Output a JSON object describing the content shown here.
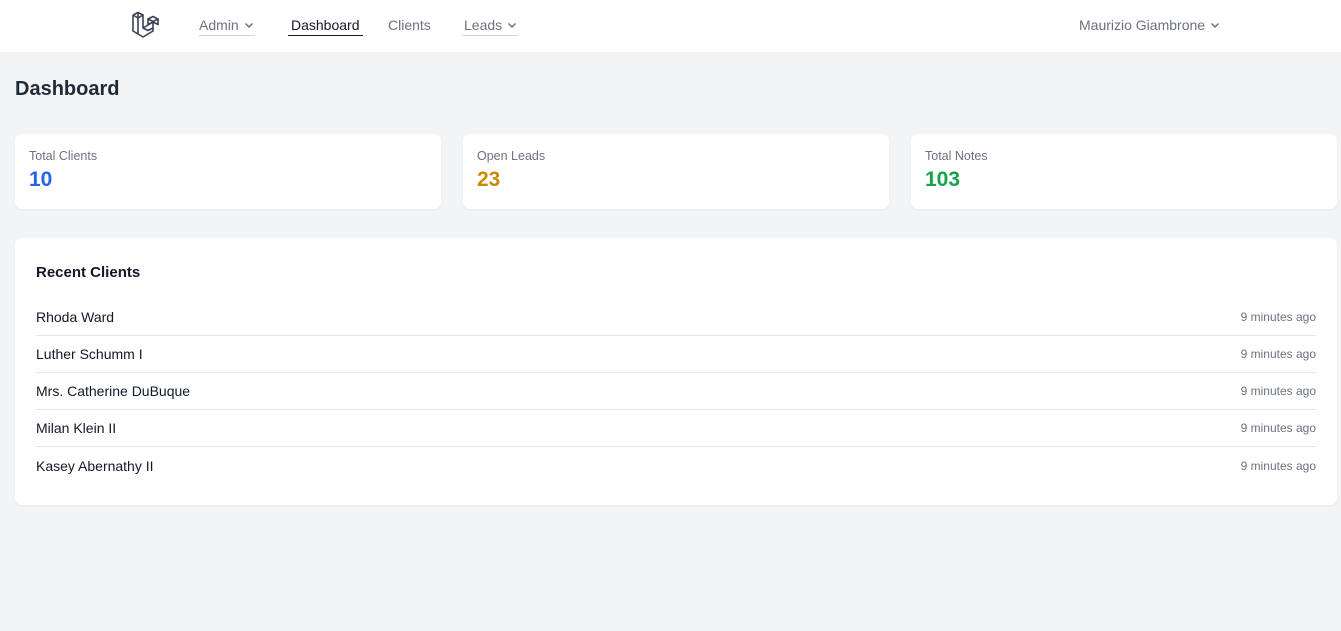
{
  "nav": {
    "items": [
      {
        "label": "Admin",
        "dropdown": true,
        "active": false
      },
      {
        "label": "Dashboard",
        "dropdown": false,
        "active": true
      },
      {
        "label": "Clients",
        "dropdown": false,
        "active": false
      },
      {
        "label": "Leads",
        "dropdown": true,
        "active": false
      }
    ],
    "user_name": "Maurizio Giambrone"
  },
  "page": {
    "title": "Dashboard"
  },
  "stats": [
    {
      "label": "Total Clients",
      "value": "10",
      "color": "#2563eb"
    },
    {
      "label": "Open Leads",
      "value": "23",
      "color": "#ca8a04"
    },
    {
      "label": "Total Notes",
      "value": "103",
      "color": "#16a34a"
    }
  ],
  "recent_clients": {
    "title": "Recent Clients",
    "items": [
      {
        "name": "Rhoda Ward",
        "time": "9 minutes ago"
      },
      {
        "name": "Luther Schumm I",
        "time": "9 minutes ago"
      },
      {
        "name": "Mrs. Catherine DuBuque",
        "time": "9 minutes ago"
      },
      {
        "name": "Milan Klein II",
        "time": "9 minutes ago"
      },
      {
        "name": "Kasey Abernathy II",
        "time": "9 minutes ago"
      }
    ]
  }
}
